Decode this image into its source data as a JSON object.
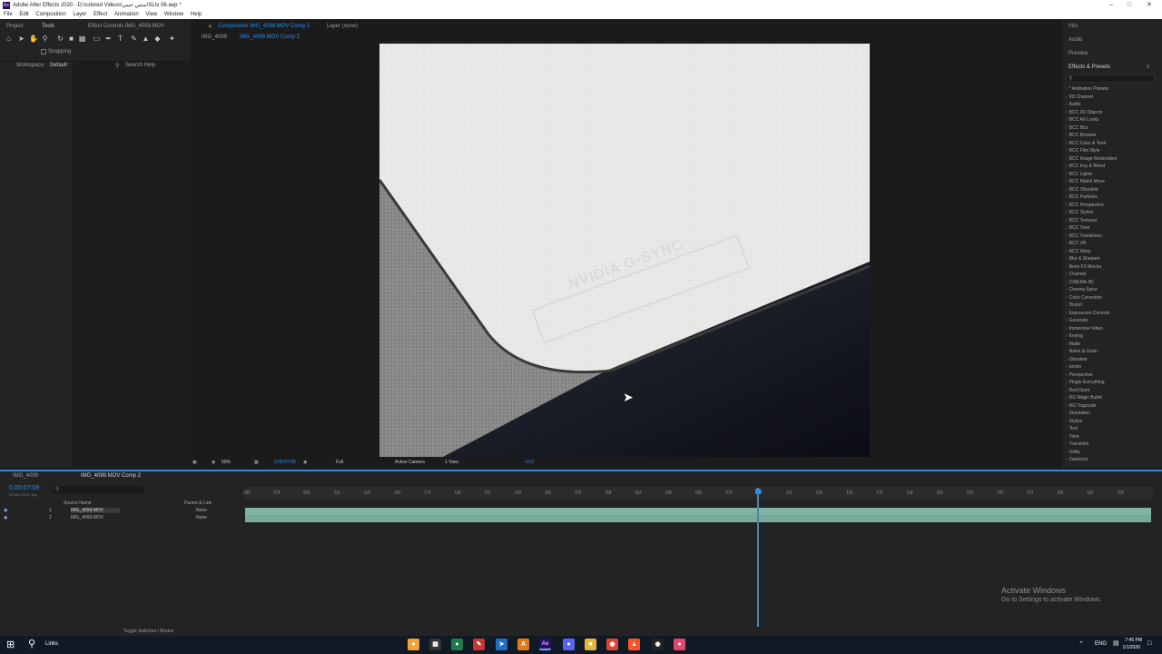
{
  "window": {
    "title": "Adobe After Effects 2020 - D:\\colored Videos\\ستين جيبي\\SLtv 06.aep *",
    "app_badge": "Ae"
  },
  "menu": [
    "File",
    "Edit",
    "Composition",
    "Layer",
    "Effect",
    "Animation",
    "View",
    "Window",
    "Help"
  ],
  "panels": {
    "project_tab": "Project",
    "tools_tab": "Tools",
    "effect_controls_tab": "Effect Controls IMG_4099.MOV",
    "composition_tab": "Composition IMG_4099.MOV Comp 2",
    "layer_tab": "Layer (none)",
    "snapping_label": "Snapping",
    "workspace_label": "Workspace:",
    "workspace_value": "Default",
    "search_help": "Search Help"
  },
  "comp": {
    "breadcrumb_1": "IMG_4099",
    "breadcrumb_2": "IMG_4099.MOV Comp 2",
    "zoom": "50%",
    "timecode": "0:00:07:09",
    "resolution": "Full",
    "camera": "Active Camera",
    "views": "1 View",
    "exposure": "+0.0"
  },
  "right_panel": {
    "info": "Info",
    "audio": "Audio",
    "preview": "Preview",
    "effects_presets": "Effects & Presets",
    "search_placeholder": "",
    "items": [
      "* Animation Presets",
      "3D Channel",
      "Audio",
      "BCC 3D Objects",
      "BCC Art Looks",
      "BCC Blur",
      "BCC Browser",
      "BCC Color & Tone",
      "BCC Film Style",
      "BCC Image Restoration",
      "BCC Key & Blend",
      "BCC Lights",
      "BCC Match Move",
      "BCC Obsolete",
      "BCC Particles",
      "BCC Perspective",
      "BCC Stylize",
      "BCC Textures",
      "BCC Time",
      "BCC Transitions",
      "BCC VR",
      "BCC Warp",
      "Blur & Sharpen",
      "Boris FX Mocha",
      "Channel",
      "CINEMA 4D",
      "Cinema Spice",
      "Color Correction",
      "Distort",
      "Expression Controls",
      "Generate",
      "Immersive Video",
      "Keying",
      "Matte",
      "Noise & Grain",
      "Obsolete",
      "omino",
      "Perspective",
      "Plugin Everything",
      "Red Giant",
      "RG Magic Bullet",
      "RG Trapcode",
      "Simulation",
      "Stylize",
      "Text",
      "Time",
      "Transition",
      "Utility",
      "Zaebects"
    ]
  },
  "timeline": {
    "tab_1": "IMG_4099",
    "tab_2": "IMG_4099.MOV Comp 2",
    "timecode": "0:00:07:09",
    "frame_info": "00189 (25.00 fps)",
    "col_source_name": "Source Name",
    "col_parent": "Parent & Link",
    "layers": [
      {
        "index": "1",
        "name": "IMG_4099.MOV",
        "parent": "None"
      },
      {
        "index": "2",
        "name": "IMG_4099.MOV",
        "parent": "None"
      }
    ],
    "ruler": [
      "05f",
      "07f",
      "09f",
      "11f",
      "13f",
      "15f",
      "17f",
      "19f",
      "21f",
      "23f",
      "25f",
      "27f",
      "29f",
      "01f",
      "03f",
      "05f",
      "07f",
      "09f",
      "11f",
      "13f",
      "15f",
      "17f",
      "19f",
      "21f",
      "23f",
      "25f",
      "27f",
      "29f",
      "01f",
      "03f"
    ],
    "toggle_label": "Toggle Switches / Modes"
  },
  "watermark": {
    "line1": "Activate Windows",
    "line2": "Go to Settings to activate Windows."
  },
  "taskbar": {
    "search": "Links",
    "lang": "ENG",
    "time": "7:45 PM",
    "date": "1/1/2026"
  },
  "viewer_logo_text": "NVIDIA  G-SYNC"
}
